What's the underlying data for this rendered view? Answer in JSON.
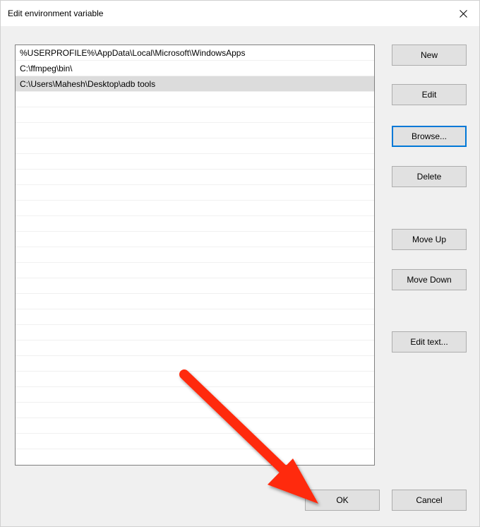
{
  "window": {
    "title": "Edit environment variable"
  },
  "paths": [
    "%USERPROFILE%\\AppData\\Local\\Microsoft\\WindowsApps",
    "C:\\ffmpeg\\bin\\",
    "C:\\Users\\Mahesh\\Desktop\\adb tools"
  ],
  "selected_index": 2,
  "buttons": {
    "new": "New",
    "edit": "Edit",
    "browse": "Browse...",
    "delete": "Delete",
    "move_up": "Move Up",
    "move_down": "Move Down",
    "edit_text": "Edit text...",
    "ok": "OK",
    "cancel": "Cancel"
  },
  "annotation": {
    "arrow_color": "#ff2a10"
  }
}
